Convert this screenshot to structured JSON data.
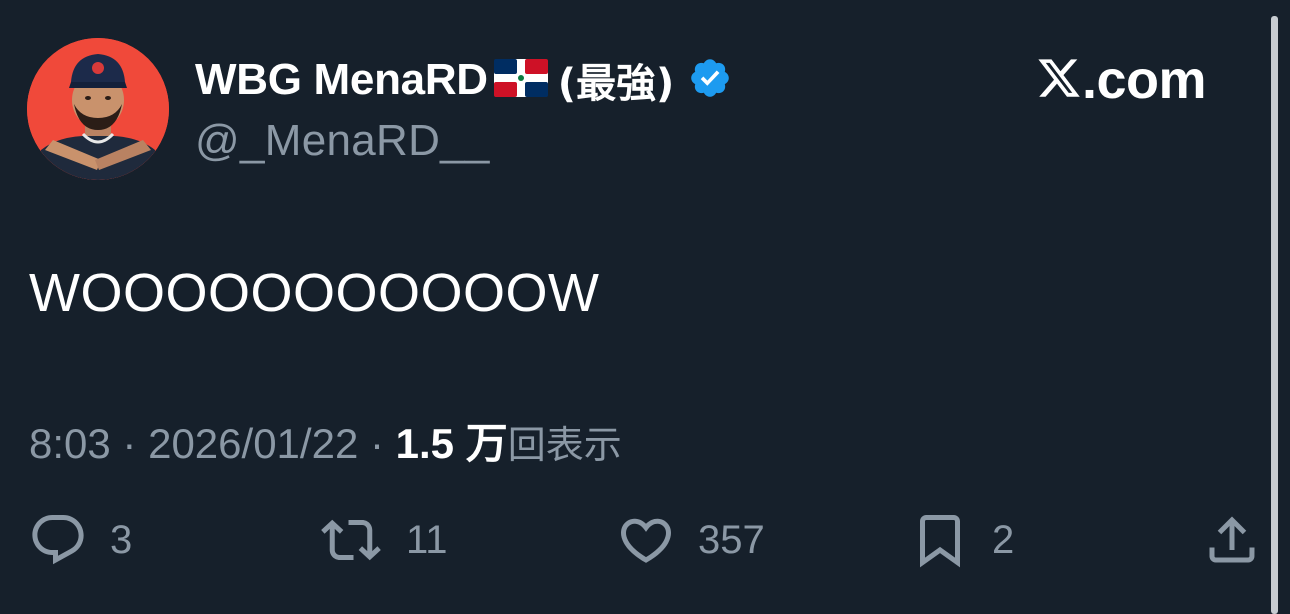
{
  "author": {
    "display_name": "WBG MenaRD",
    "name_suffix": "(最強)",
    "handle": "@_MenaRD__",
    "flag_icon": "dominican-republic-flag",
    "verified_icon": "verified-badge-icon",
    "verified_color": "#1d9bf0",
    "avatar_background": "#f0493a"
  },
  "brand": {
    "logo_icon": "x-logo-icon",
    "domain_text": ".com"
  },
  "tweet": {
    "text": "WOOOOOOOOOOOW"
  },
  "meta": {
    "time": "8:03",
    "separator": "·",
    "date": "2026/01/22",
    "views_count": "1.5 万",
    "views_label": "回表示"
  },
  "actions": {
    "reply": {
      "icon": "reply-icon",
      "count": "3"
    },
    "repost": {
      "icon": "repost-icon",
      "count": "11"
    },
    "like": {
      "icon": "heart-icon",
      "count": "357"
    },
    "bookmark": {
      "icon": "bookmark-icon",
      "count": "2"
    },
    "share": {
      "icon": "share-icon"
    }
  },
  "colors": {
    "background": "#16202b",
    "primary_text": "#ffffff",
    "secondary_text": "#8b98a5"
  }
}
